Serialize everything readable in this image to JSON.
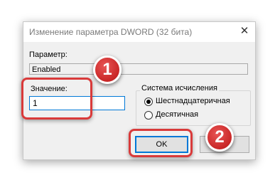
{
  "dialog": {
    "title": "Изменение параметра DWORD (32 бита)",
    "close_glyph": "✕"
  },
  "value_name": {
    "label": "Параметр:",
    "value": "Enabled"
  },
  "value_data": {
    "label": "Значение:",
    "value": "1"
  },
  "base": {
    "title": "Система исчисления",
    "options": [
      {
        "label": "Шестнадцатеричная",
        "selected": true
      },
      {
        "label": "Десятичная",
        "selected": false
      }
    ]
  },
  "buttons": {
    "ok_label": "OK"
  },
  "annotations": {
    "marker_1": "1",
    "marker_2": "2",
    "color": "#d93a3a"
  }
}
